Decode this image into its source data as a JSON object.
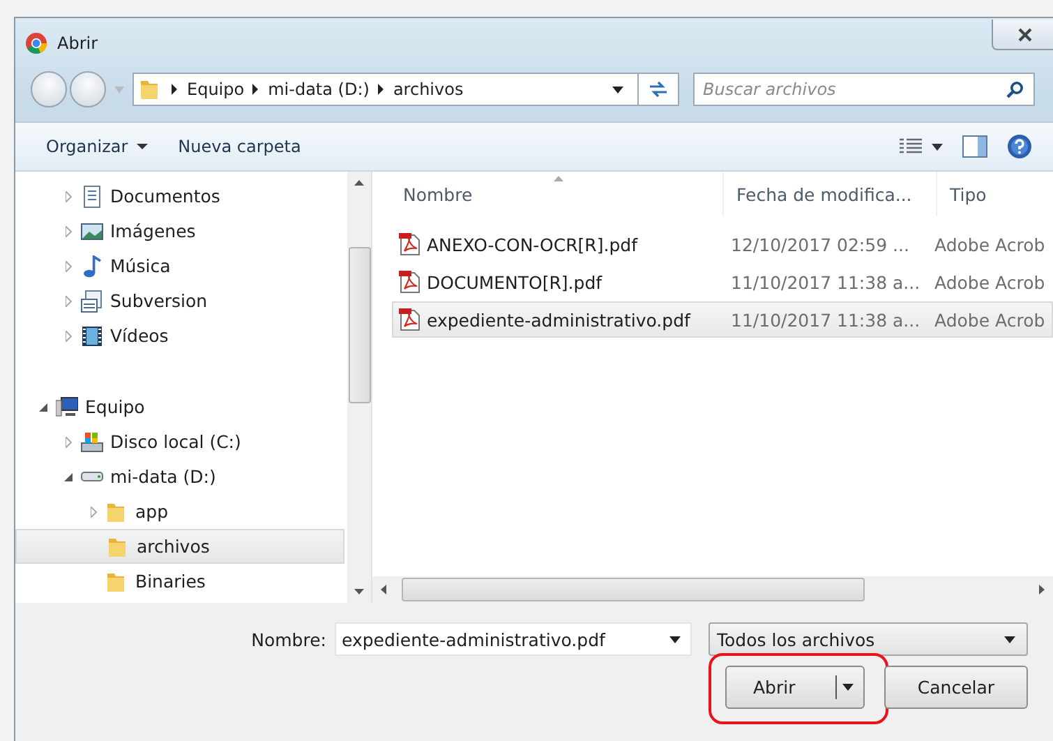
{
  "window": {
    "title": "Abrir"
  },
  "address_bar": {
    "crumbs": [
      "Equipo",
      "mi-data (D:)",
      "archivos"
    ]
  },
  "search": {
    "placeholder": "Buscar archivos"
  },
  "toolbar": {
    "buttons": [
      {
        "label": "Organizar",
        "dropdown": true
      },
      {
        "label": "Nueva carpeta",
        "dropdown": false
      }
    ]
  },
  "nav_pane": {
    "library_items": [
      {
        "label": "Documentos",
        "kind": "documents",
        "expanded": false
      },
      {
        "label": "Imágenes",
        "kind": "pictures",
        "expanded": false
      },
      {
        "label": "Música",
        "kind": "music",
        "expanded": false
      },
      {
        "label": "Subversion",
        "kind": "subversion",
        "expanded": false
      },
      {
        "label": "Vídeos",
        "kind": "videos",
        "expanded": false
      }
    ],
    "roots": [
      {
        "label": "Equipo",
        "kind": "computer",
        "expanded": true,
        "selected": false,
        "children": [
          {
            "label": "Disco local (C:)",
            "kind": "system-drive",
            "expanded": false,
            "selected": false
          },
          {
            "label": "mi-data (D:)",
            "kind": "drive",
            "expanded": true,
            "selected": false,
            "children": [
              {
                "label": "app",
                "kind": "folder",
                "expanded": false,
                "selected": false
              },
              {
                "label": "archivos",
                "kind": "folder",
                "selected": true
              },
              {
                "label": "Binaries",
                "kind": "folder",
                "selected": false
              }
            ]
          }
        ]
      }
    ]
  },
  "file_list": {
    "columns": [
      "Nombre",
      "Fecha de modifica...",
      "Tipo"
    ],
    "rows": [
      {
        "name": "ANEXO-CON-OCR[R].pdf",
        "date": "12/10/2017 02:59 ...",
        "type": "Adobe Acrob",
        "selected": false
      },
      {
        "name": "DOCUMENTO[R].pdf",
        "date": "11/10/2017 11:38 a...",
        "type": "Adobe Acrob",
        "selected": false
      },
      {
        "name": "expediente-administrativo.pdf",
        "date": "11/10/2017 11:38 a...",
        "type": "Adobe Acrob",
        "selected": true
      }
    ]
  },
  "footer": {
    "name_label": "Nombre:",
    "name_value": "expediente-administrativo.pdf",
    "filter": "Todos los archivos",
    "buttons": [
      {
        "label": "Abrir",
        "kind": "split",
        "highlighted": true
      },
      {
        "label": "Cancelar",
        "kind": "plain",
        "highlighted": false
      }
    ]
  }
}
